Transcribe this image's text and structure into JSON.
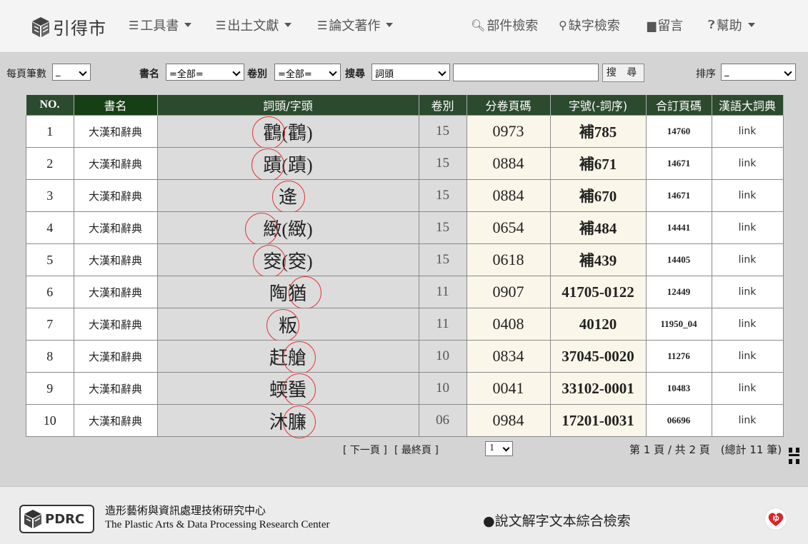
{
  "header": {
    "logo_text": "引得市",
    "menus": [
      {
        "label": "工具書",
        "icon": "menu-lines-icon",
        "dropdown": true
      },
      {
        "label": "出土文獻",
        "icon": "menu-lines-icon",
        "dropdown": true
      },
      {
        "label": "論文著作",
        "icon": "menu-lines-icon",
        "dropdown": true
      }
    ],
    "right_links": [
      {
        "label": "部件檢索",
        "icon": "search-icon"
      },
      {
        "label": "缺字檢索",
        "icon": "key-search-icon"
      },
      {
        "label": "留言",
        "icon": "comment-icon"
      },
      {
        "label": "幫助",
        "icon": "help-icon",
        "dropdown": true
      }
    ]
  },
  "filters": {
    "per_page_label": "每頁筆數",
    "per_page_value": "_",
    "book_label": "書名",
    "book_value": "=全部=",
    "volume_label": "卷別",
    "volume_value": "=全部=",
    "search_label": "搜尋",
    "search_field_value": "詞頭",
    "search_input_value": "",
    "search_button": "搜 尋",
    "sort_label": "排序",
    "sort_value": "_"
  },
  "table": {
    "columns": [
      "NO.",
      "書名",
      "詞頭/字頭",
      "卷別",
      "分卷頁碼",
      "字號(-詞序)",
      "合訂頁碼",
      "漢語大詞典"
    ],
    "rows": [
      {
        "no": "1",
        "book": "大漢和辭典",
        "head": "鸖(鸖)",
        "vol": "15",
        "page": "0973",
        "code": "補785",
        "combined": "14760",
        "link": "link"
      },
      {
        "no": "2",
        "book": "大漢和辭典",
        "head": "蹟(蹟)",
        "vol": "15",
        "page": "0884",
        "code": "補671",
        "combined": "14671",
        "link": "link"
      },
      {
        "no": "3",
        "book": "大漢和辭典",
        "head": "逄",
        "vol": "15",
        "page": "0884",
        "code": "補670",
        "combined": "14671",
        "link": "link"
      },
      {
        "no": "4",
        "book": "大漢和辭典",
        "head": "緻(緻)",
        "vol": "15",
        "page": "0654",
        "code": "補484",
        "combined": "14441",
        "link": "link"
      },
      {
        "no": "5",
        "book": "大漢和辭典",
        "head": "窔(窔)",
        "vol": "15",
        "page": "0618",
        "code": "補439",
        "combined": "14405",
        "link": "link"
      },
      {
        "no": "6",
        "book": "大漢和辭典",
        "head": "陶猶",
        "vol": "11",
        "page": "0907",
        "code": "41705-0122",
        "combined": "12449",
        "link": "link"
      },
      {
        "no": "7",
        "book": "大漢和辭典",
        "head": "粄",
        "vol": "11",
        "page": "0408",
        "code": "40120",
        "combined": "11950_04",
        "link": "link"
      },
      {
        "no": "8",
        "book": "大漢和辭典",
        "head": "赶艙",
        "vol": "10",
        "page": "0834",
        "code": "37045-0020",
        "combined": "11276",
        "link": "link"
      },
      {
        "no": "9",
        "book": "大漢和辭典",
        "head": "蝡蜑",
        "vol": "10",
        "page": "0041",
        "code": "33102-0001",
        "combined": "10483",
        "link": "link"
      },
      {
        "no": "10",
        "book": "大漢和辭典",
        "head": "沐臁",
        "vol": "06",
        "page": "0984",
        "code": "17201-0031",
        "combined": "06696",
        "link": "link"
      }
    ]
  },
  "pager": {
    "next": "[ 下一頁 ]",
    "last": "[ 最終頁 ]",
    "page_select": "1",
    "info": "第 1 頁 / 共 2 頁　(總計 11 筆)"
  },
  "footer": {
    "logo_text": "PDRC",
    "org_zh": "造形藝術與資訊處理技術研究中心",
    "org_en": "The Plastic Arts & Data Processing Research Center",
    "shuowen_link": "●說文解字文本綜合檢索"
  }
}
